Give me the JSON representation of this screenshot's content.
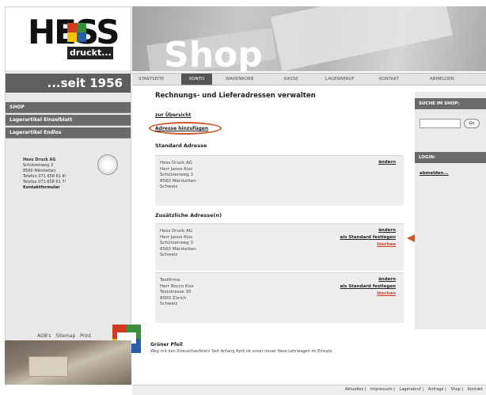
{
  "brand": {
    "logo_text": "HESS",
    "tagline": "druckt...",
    "since": "...seit 1956",
    "colors": {
      "red": "#d23b1f",
      "green": "#3a8f3a",
      "yellow": "#f0c400",
      "blue": "#2a5ea8",
      "accent": "#d0562a"
    }
  },
  "header": {
    "title": "Shop"
  },
  "topnav": {
    "items": [
      {
        "label": "STARTSEITE",
        "active": false
      },
      {
        "label": "KONTO",
        "active": true
      },
      {
        "label": "WARENKORB",
        "active": false
      },
      {
        "label": "KASSE",
        "active": false
      },
      {
        "label": "LAGERABRUF",
        "active": false
      },
      {
        "label": "KONTAKT",
        "active": false
      },
      {
        "label": "ABMELDEN",
        "active": false
      }
    ]
  },
  "sidebar": {
    "items": [
      {
        "label": "SHOP"
      },
      {
        "label": "Lagerartikel Einzelblatt"
      },
      {
        "label": "Lagerartikel Endlos"
      }
    ]
  },
  "contact": {
    "company": "Hess Druck AG",
    "street": "Schützenweg 3",
    "city": "8560 Märstetten",
    "phone": "Telefon 071 658 61 6!",
    "fax": "Telefax 071 658 61 7!",
    "link": "Kontaktformular"
  },
  "left_footer": {
    "links": [
      "AGB's",
      "Sitemap",
      "Print"
    ]
  },
  "main": {
    "title": "Rechnungs- und Lieferadressen verwalten",
    "overview_link": "zur Übersicht",
    "add_button": "Adresse hinzufügen",
    "standard_title": "Standard Adresse",
    "standard_address": {
      "lines": [
        "Hess Druck AG",
        "Herr Janos Kiss",
        "Schützenweg 3",
        "8560 Märstetten",
        "Schweiz"
      ],
      "edit": "ändern"
    },
    "additional_title": "Zusätzliche Adresse(n)",
    "additional_addresses": [
      {
        "lines": [
          "Hess Druck AG",
          "Herr Janos Kiss",
          "Schützenweg 3",
          "8560 Märstetten",
          "Schweiz"
        ],
        "edit": "ändern",
        "set_default": "als Standard festlegen",
        "delete": "löschen"
      },
      {
        "lines": [
          "Testfirma",
          "Herr Rocco Kiss",
          "Teststrasse 30",
          "8000 Zürich",
          "Schweiz"
        ],
        "edit": "ändern",
        "set_default": "als Standard festlegen",
        "delete": "löschen"
      }
    ]
  },
  "right": {
    "search_title": "SUCHE IM SHOP:",
    "search_placeholder": "",
    "search_button": "Go",
    "login_title": "LOGIN:",
    "login_link": "abmelden..."
  },
  "news": {
    "title": "Grüner Pfeil",
    "text": "Weg mit den Streuschaufelen! Seit Anfang April ist unser neuer Hess-Lehrwagen im Einsatz."
  },
  "footer": {
    "links": [
      "Aktuelles",
      "Impressum",
      "Lagerabruf",
      "Anfrage",
      "Shop",
      "Kontakt"
    ]
  }
}
